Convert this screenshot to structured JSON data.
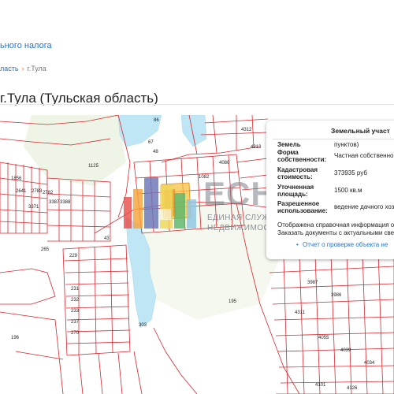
{
  "header": {
    "tax_link": "ьного налога",
    "breadcrumb": {
      "parent": "ласть",
      "separator": "›",
      "current": "г.Тула"
    },
    "title": "г.Тула (Тульская область)"
  },
  "map": {
    "parcel_labels": [
      "86",
      "67",
      "48",
      "1125",
      "1856",
      "2641",
      "2783",
      "2782",
      "3371",
      "3387",
      "3388",
      "43",
      "265",
      "229",
      "231",
      "232",
      "233",
      "237",
      "270",
      "196",
      "195",
      "4312",
      "4313",
      "4080",
      "1082",
      "3987",
      "3986",
      "4311",
      "4055",
      "4039",
      "4034",
      "4101",
      "4126",
      "303"
    ],
    "colors": {
      "boundary": "#d7262e",
      "water": "#bfe6f5",
      "background": "#ffffff",
      "forest": "#eef5e6"
    }
  },
  "watermark": {
    "logo_letters": "ЕСН",
    "line1": "ЕДИНАЯ СЛУЖБА",
    "line2": "НЕДВИЖИМОСТИ"
  },
  "popup": {
    "title": "Земельный участ",
    "rows": [
      {
        "label": "Земель",
        "value": "пунктов)"
      },
      {
        "label": "Форма собственности:",
        "value": "Частная собственно"
      },
      {
        "label": "Кадастровая стоимость:",
        "value": "373935 руб"
      },
      {
        "label": "Уточненная площадь:",
        "value": "1500 кв.м"
      },
      {
        "label": "Разрешенное использование:",
        "value": "ведение дачного хозя"
      }
    ],
    "note_line1": "Отображена справочная информация об",
    "note_line2": "Заказать документы с актуальными свед",
    "link_bullet": "•",
    "link": "Отчет о проверке объекта не"
  }
}
